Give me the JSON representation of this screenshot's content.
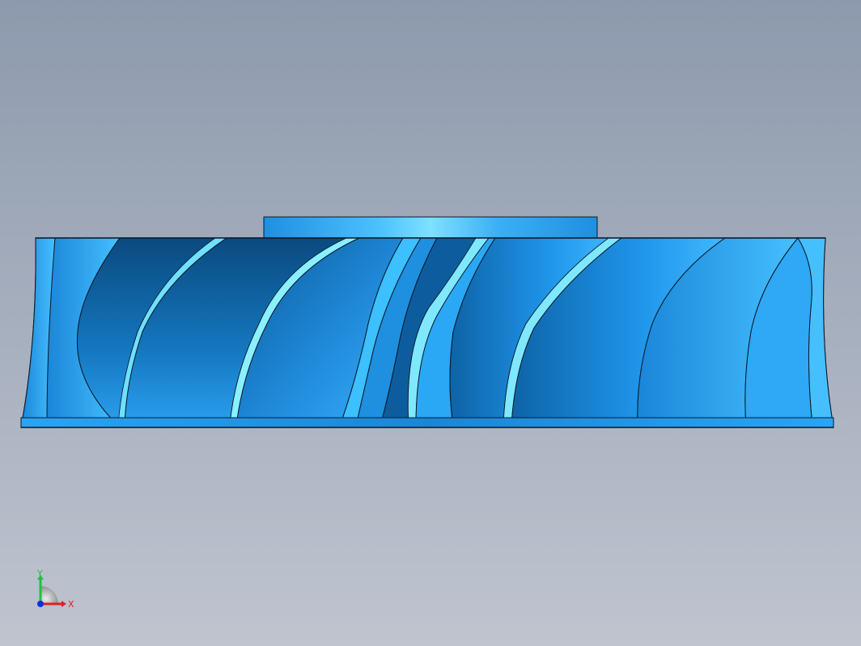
{
  "viewport": {
    "background_top": "#8d9aad",
    "background_bottom": "#bfc4cf",
    "model": {
      "name": "impeller",
      "view": "front",
      "part_color": "#1e90e0",
      "edge_color": "#0a1a2a",
      "highlight_color": "#7fe8ff",
      "shadow_color": "#0a3f6e"
    }
  },
  "triad": {
    "x_label": "X",
    "y_label": "Y",
    "x_color": "#e02020",
    "y_color": "#20c040",
    "origin_color": "#1030e0"
  }
}
